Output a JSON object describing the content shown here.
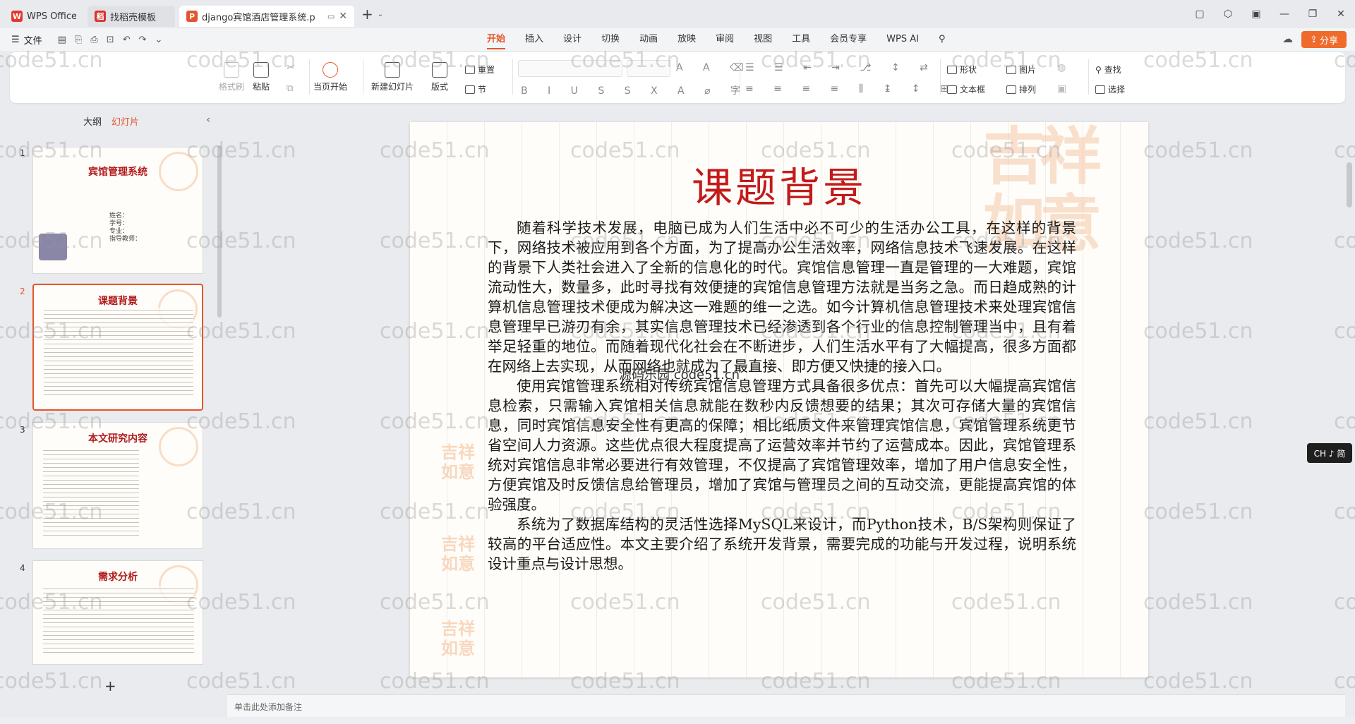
{
  "window": {
    "tabs": [
      {
        "label": "WPS Office",
        "icon": "wps-logo-icon"
      },
      {
        "label": "找稻壳模板",
        "icon": "template-icon"
      },
      {
        "label": "django宾馆酒店管理系统.p",
        "icon": "ppt-file-icon"
      }
    ]
  },
  "menu": {
    "file_label": "文件",
    "ribbon_tabs": [
      "开始",
      "插入",
      "设计",
      "切换",
      "动画",
      "放映",
      "审阅",
      "视图",
      "工具",
      "会员专享"
    ],
    "active_tab": "开始",
    "ai_label": "WPS AI",
    "share_label": "分享"
  },
  "toolbar": {
    "format_painter": "格式刷",
    "paste": "粘贴",
    "from_current": "当页开始",
    "new_slide": "新建幻灯片",
    "layout": "版式",
    "section": "节",
    "reset": "重置",
    "shape": "形状",
    "picture": "图片",
    "textbox": "文本框",
    "arrange": "排列",
    "find": "查找",
    "select": "选择"
  },
  "left_panel": {
    "outline_tab": "大纲",
    "slides_tab": "幻灯片",
    "thumbnails": [
      {
        "num": "1",
        "title": "宾馆管理系统",
        "info": [
          "姓名：",
          "学号：",
          "专业：",
          "指导教师："
        ]
      },
      {
        "num": "2",
        "title": "课题背景"
      },
      {
        "num": "3",
        "title": "本文研究内容"
      },
      {
        "num": "4",
        "title": "需求分析"
      }
    ],
    "add_slide": "+"
  },
  "slide": {
    "title": "课题背景",
    "paragraphs": [
      "随着科学技术发展，电脑已成为人们生活中必不可少的生活办公工具，在这样的背景下，网络技术被应用到各个方面，为了提高办公生活效率，网络信息技术飞速发展。在这样的背景下人类社会进入了全新的信息化的时代。宾馆信息管理一直是管理的一大难题，宾馆流动性大，数量多，此时寻找有效便捷的宾馆信息管理方法就是当务之急。而日趋成熟的计算机信息管理技术便成为解决这一难题的维一之选。如今计算机信息管理技术来处理宾馆信息管理早已游刃有余，其实信息管理技术已经渗透到各个行业的信息控制管理当中，且有着举足轻重的地位。而随着现代化社会在不断进步，人们生活水平有了大幅提高，很多方面都在网络上去实现，从而网络也就成为了最直接、即方便又快捷的接入口。",
      "使用宾馆管理系统相对传统宾馆信息管理方式具备很多优点：首先可以大幅提高宾馆信息检索，只需输入宾馆相关信息就能在数秒内反馈想要的结果；其次可存储大量的宾馆信息，同时宾馆信息安全性有更高的保障；相比纸质文件来管理宾馆信息，宾馆管理系统更节省空间人力资源。这些优点很大程度提高了运营效率并节约了运营成本。因此，宾馆管理系统对宾馆信息非常必要进行有效管理，不仅提高了宾馆管理效率，增加了用户信息安全性，方便宾馆及时反馈信息给管理员，增加了宾馆与管理员之间的互动交流，更能提高宾馆的体验强度。",
      "系统为了数据库结构的灵活性选择MySQL来设计，而Python技术，B/S架构则保证了较高的平台适应性。本文主要介绍了系统开发背景，需要完成的功能与开发过程，说明系统设计重点与设计思想。"
    ],
    "overlay_text": "源码乐园 code51.cn"
  },
  "notes_placeholder": "单击此处添加备注",
  "ime_badge": "CH ♪ 简",
  "watermark": "code51.cn",
  "colors": {
    "accent": "#e4552d",
    "title_red": "#c21b1b"
  }
}
